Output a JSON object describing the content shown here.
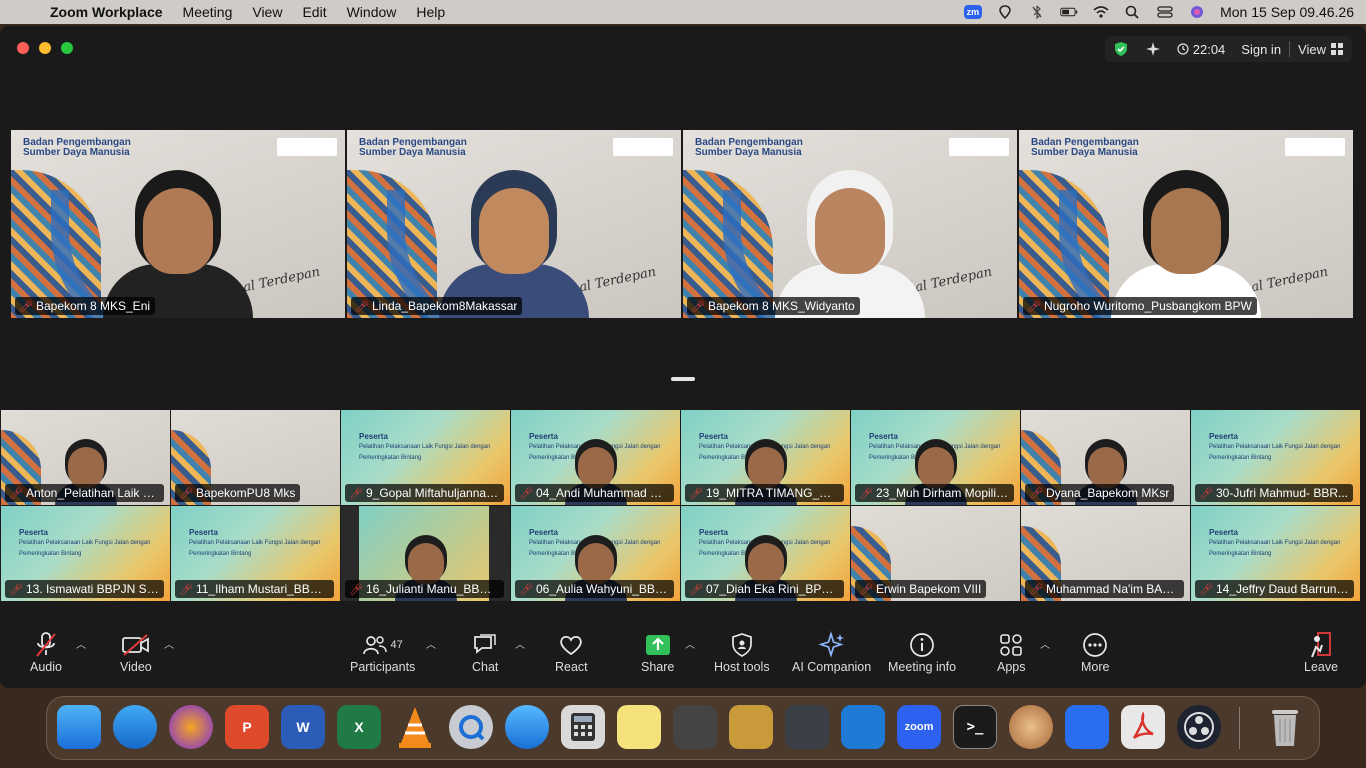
{
  "menubar": {
    "app": "Zoom Workplace",
    "items": [
      "Meeting",
      "View",
      "Edit",
      "Window",
      "Help"
    ],
    "clock": "Mon 15 Sep  09.46.26",
    "zoom_badge": "zm"
  },
  "titlebar": {
    "timer": "22:04",
    "sign_in": "Sign in",
    "view": "View"
  },
  "speakers": [
    {
      "name": "Bapekom 8 MKS_Eni"
    },
    {
      "name": "Linda_Bapekom8Makassar"
    },
    {
      "name": "Bapekom 8 MKS_Widyanto"
    },
    {
      "name": "Nugroho Wuritomo_Pusbangkom BPW"
    }
  ],
  "tile_text": {
    "logo_line1": "Badan Pengembangan",
    "logo_line2": "Sumber Daya Manusia",
    "script": "Profesional Terdepan",
    "peserta_title": "Peserta",
    "peserta_line": "Pelatihan Pelaksanaan Laik Fungsi Jalan dengan Pemeringkatan Bintang"
  },
  "gallery_row1": [
    {
      "name": "Anton_Pelatihan Laik Fu..."
    },
    {
      "name": "BapekomPU8 Mks"
    },
    {
      "name": "9_Gopal Miftahuljannah..."
    },
    {
      "name": "04_Andi Muhammad Sy..."
    },
    {
      "name": "19_MITRA TIMANG_BB..."
    },
    {
      "name": "23_Muh Dirham Mopilie..."
    },
    {
      "name": "Dyana_Bapekom MKsr"
    },
    {
      "name": "30-Jufri Mahmud- BBR..."
    }
  ],
  "gallery_row2": [
    {
      "name": "13. Ismawati BBPJN Sul..."
    },
    {
      "name": "11_Ilham Mustari_BBPJ..."
    },
    {
      "name": "16_Julianti Manu_BBPJ..."
    },
    {
      "name": "06_Aulia Wahyuni_BBP..."
    },
    {
      "name": "07_Diah Eka Rini_BPJN..."
    },
    {
      "name": "Erwin Bapekom VIII"
    },
    {
      "name": "Muhammad Na'im BAPE..."
    },
    {
      "name": "14_Jeffry Daud Barrung..."
    }
  ],
  "toolbar": {
    "audio": "Audio",
    "video": "Video",
    "participants": "Participants",
    "participants_count": "47",
    "chat": "Chat",
    "react": "React",
    "share": "Share",
    "host_tools": "Host tools",
    "ai_companion": "AI Companion",
    "meeting_info": "Meeting info",
    "apps": "Apps",
    "more": "More",
    "leave": "Leave"
  },
  "dock": {
    "zoom_label": "zoom",
    "terminal_label": ">_"
  },
  "colors": {
    "active_speaker": "#31d35c",
    "share_green": "#31c05a",
    "leave_red": "#e23b3b"
  }
}
